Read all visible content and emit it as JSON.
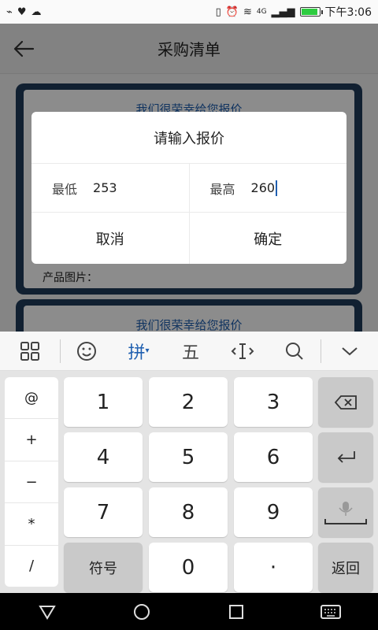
{
  "status_bar": {
    "time": "下午3:06",
    "network": "4G"
  },
  "appbar": {
    "title": "采购清单",
    "back_icon": "arrow-left-icon"
  },
  "cards": [
    {
      "header": "我们很荣幸给您报价",
      "photo_label": "产品图片："
    },
    {
      "header": "我们很荣幸给您报价"
    }
  ],
  "dialog": {
    "title": "请输入报价",
    "min_label": "最低",
    "min_value": "253",
    "max_label": "最高",
    "max_value": "260",
    "cancel": "取消",
    "confirm": "确定"
  },
  "keyboard": {
    "toolbar": {
      "grid_icon": "grid-icon",
      "emoji_icon": "smiley-icon",
      "pinyin": "拼",
      "wubi": "五",
      "cursor_icon": "cursor-icon",
      "search_icon": "search-icon",
      "collapse_icon": "chevron-down-icon"
    },
    "side": [
      "@",
      "+",
      "−",
      "*",
      "/"
    ],
    "digits": [
      "1",
      "2",
      "3",
      "4",
      "5",
      "6",
      "7",
      "8",
      "9"
    ],
    "symbol": "符号",
    "zero": "0",
    "dot": "·",
    "back": "返回"
  },
  "nav": {
    "back": "triangle-back-icon",
    "home": "circle-home-icon",
    "recent": "square-recent-icon",
    "keyboard": "keyboard-icon"
  },
  "colors": {
    "accent": "#1f5fb0",
    "card_border": "#1f3b5a"
  }
}
